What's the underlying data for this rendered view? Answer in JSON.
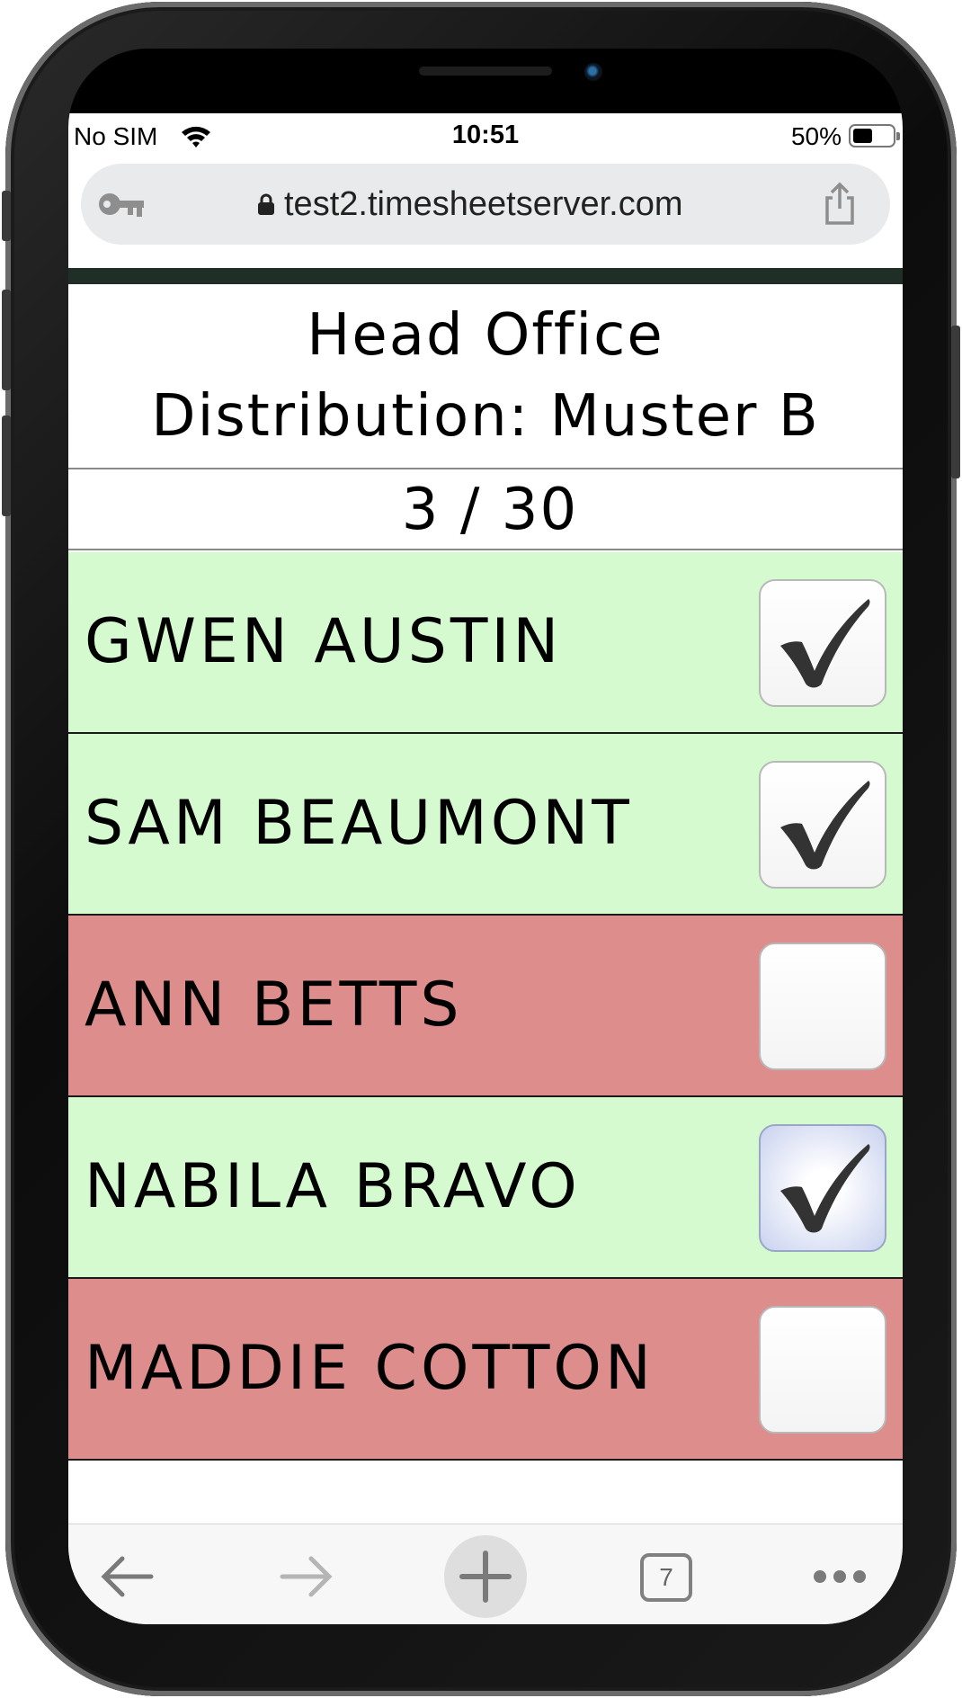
{
  "status_bar": {
    "carrier": "No SIM",
    "time": "10:51",
    "battery_percent": "50%",
    "battery_level": 0.5
  },
  "browser": {
    "url": "test2.timesheetserver.com",
    "tab_count": "7"
  },
  "page": {
    "title_line1": "Head Office",
    "title_line2": "Distribution: Muster B",
    "count": "3 / 30"
  },
  "people": [
    {
      "name": "GWEN AUSTIN",
      "checked": true,
      "status": "present"
    },
    {
      "name": "SAM BEAUMONT",
      "checked": true,
      "status": "present"
    },
    {
      "name": "ANN BETTS",
      "checked": false,
      "status": "absent"
    },
    {
      "name": "NABILA BRAVO",
      "checked": true,
      "status": "present",
      "focused": true
    },
    {
      "name": "MADDIE COTTON",
      "checked": false,
      "status": "absent"
    }
  ],
  "colors": {
    "present_row": "#d5fad0",
    "absent_row": "#dd8d8c",
    "header_bar": "#1f2f28"
  },
  "icons": {
    "toolbar": [
      "back-arrow-icon",
      "forward-arrow-icon",
      "new-tab-plus-icon",
      "tabs-icon",
      "more-icon"
    ],
    "address_bar": [
      "key-icon",
      "lock-icon",
      "share-icon"
    ]
  }
}
